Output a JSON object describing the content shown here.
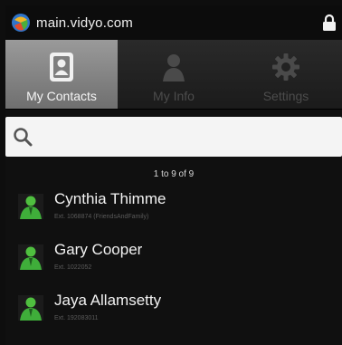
{
  "status_bar": {
    "domain": "main.vidyo.com"
  },
  "tabs": [
    {
      "label": "My Contacts",
      "icon": "contact-card-icon",
      "active": true
    },
    {
      "label": "My Info",
      "icon": "person-icon",
      "active": false
    },
    {
      "label": "Settings",
      "icon": "gear-icon",
      "active": false
    }
  ],
  "search": {
    "placeholder": "",
    "value": ""
  },
  "list": {
    "range": "1 to 9 of 9",
    "contacts": [
      {
        "name": "Cynthia Thimme",
        "ext": "Ext. 1068874",
        "group": "(FriendsAndFamily)"
      },
      {
        "name": "Gary Cooper",
        "ext": "Ext. 1022052",
        "group": ""
      },
      {
        "name": "Jaya Allamsetty",
        "ext": "Ext. 192083011",
        "group": ""
      }
    ]
  },
  "colors": {
    "active_tab": "#8a8a8a",
    "avatar_green": "#3fae3a",
    "background": "#101010"
  }
}
